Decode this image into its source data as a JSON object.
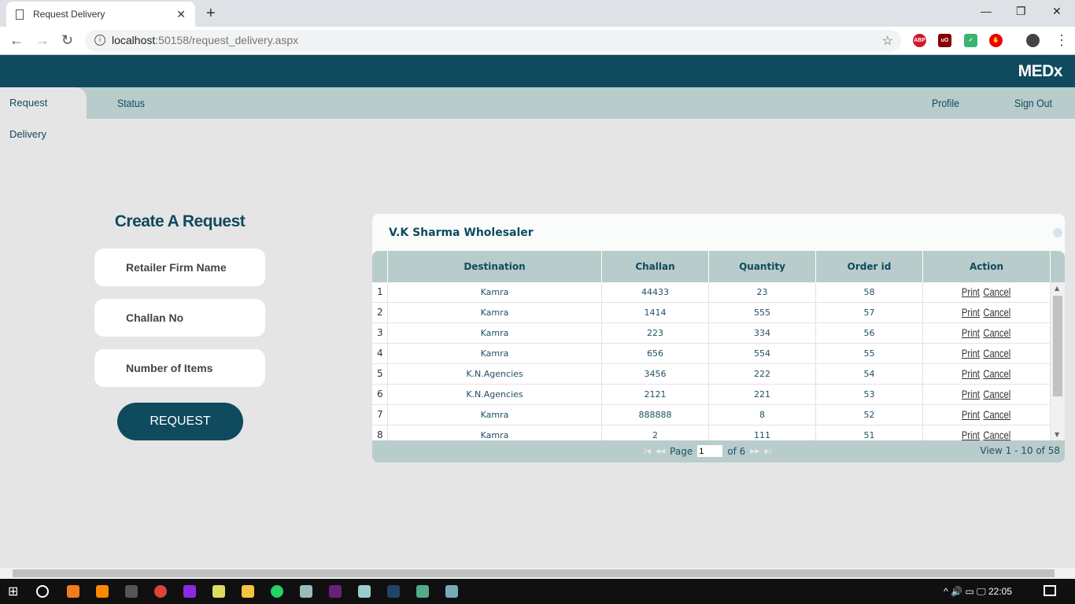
{
  "browser": {
    "tab_title": "Request Delivery",
    "url_host": "localhost",
    "url_path": ":50158/request_delivery.aspx"
  },
  "app": {
    "brand": "MEDx",
    "nav": {
      "request_delivery": "Request Delivery",
      "status": "Status",
      "profile": "Profile",
      "sign_out": "Sign Out"
    }
  },
  "form": {
    "title": "Create A Request",
    "fields": [
      "Retailer Firm Name",
      "Challan No",
      "Number of Items"
    ],
    "button": "REQUEST"
  },
  "grid": {
    "caption": "V.K Sharma Wholesaler",
    "columns": [
      "Destination",
      "Challan",
      "Quantity",
      "Order id",
      "Action"
    ],
    "rows": [
      {
        "n": "1",
        "destination": "Kamra",
        "challan": "44433",
        "quantity": "23",
        "order_id": "58"
      },
      {
        "n": "2",
        "destination": "Kamra",
        "challan": "1414",
        "quantity": "555",
        "order_id": "57"
      },
      {
        "n": "3",
        "destination": "Kamra",
        "challan": "223",
        "quantity": "334",
        "order_id": "56"
      },
      {
        "n": "4",
        "destination": "Kamra",
        "challan": "656",
        "quantity": "554",
        "order_id": "55"
      },
      {
        "n": "5",
        "destination": "K.N.Agencies",
        "challan": "3456",
        "quantity": "222",
        "order_id": "54"
      },
      {
        "n": "6",
        "destination": "K.N.Agencies",
        "challan": "2121",
        "quantity": "221",
        "order_id": "53"
      },
      {
        "n": "7",
        "destination": "Kamra",
        "challan": "888888",
        "quantity": "8",
        "order_id": "52"
      },
      {
        "n": "8",
        "destination": "Kamra",
        "challan": "2",
        "quantity": "111",
        "order_id": "51"
      }
    ],
    "print_label": "Print",
    "cancel_label": "Cancel",
    "pager": {
      "page_label": "Page",
      "page_value": "1",
      "of_label": "of 6",
      "view": "View 1 - 10 of 58"
    }
  },
  "taskbar": {
    "time": "22:05"
  }
}
